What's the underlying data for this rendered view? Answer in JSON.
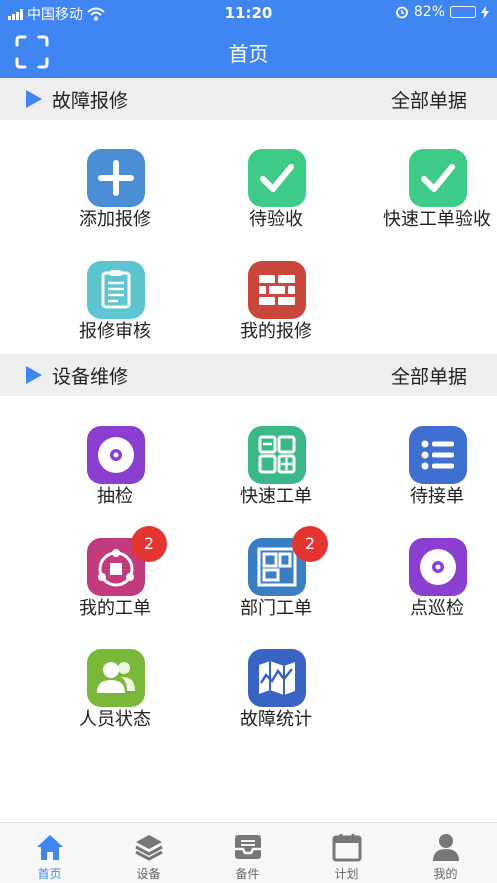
{
  "status_bar": {
    "carrier": "中国移动",
    "time": "11:20",
    "battery": "82%",
    "battery_level": 0.82
  },
  "header": {
    "title": "首页",
    "scan_icon": "scan-frame-icon"
  },
  "sections": [
    {
      "title": "故障报修",
      "all_label": "全部单据",
      "items": [
        {
          "label": "添加报修",
          "icon": "plus-icon",
          "color": "#4a8fd6"
        },
        {
          "label": "待验收",
          "icon": "checkmark-icon",
          "color": "#3ecb87"
        },
        {
          "label": "快速工单验收",
          "icon": "checkmark-icon",
          "color": "#3ecb87"
        },
        {
          "label": "报修审核",
          "icon": "clipboard-icon",
          "color": "#5cc5cf"
        },
        {
          "label": "我的报修",
          "icon": "brick-wall-icon",
          "color": "#c9473c"
        }
      ]
    },
    {
      "title": "设备维修",
      "all_label": "全部单据",
      "items": [
        {
          "label": "抽检",
          "icon": "target-disc-icon",
          "color": "#8a3fd1"
        },
        {
          "label": "快速工单",
          "icon": "calculator-icon",
          "color": "#3ab888"
        },
        {
          "label": "待接单",
          "icon": "list-icon",
          "color": "#3f6fd0"
        },
        {
          "label": "我的工单",
          "icon": "network-icon",
          "color": "#c23b7f",
          "badge": "2"
        },
        {
          "label": "部门工单",
          "icon": "floorplan-icon",
          "color": "#3a7fc4",
          "badge": "2"
        },
        {
          "label": "点巡检",
          "icon": "target-disc-icon",
          "color": "#8a3fd1"
        },
        {
          "label": "人员状态",
          "icon": "people-icon",
          "color": "#7ab83a"
        },
        {
          "label": "故障统计",
          "icon": "folded-map-icon",
          "color": "#3a64c4"
        }
      ]
    }
  ],
  "tabs": [
    {
      "label": "首页",
      "icon": "home-icon",
      "active": true
    },
    {
      "label": "设备",
      "icon": "layers-icon",
      "active": false
    },
    {
      "label": "备件",
      "icon": "inbox-icon",
      "active": false
    },
    {
      "label": "计划",
      "icon": "calendar-icon",
      "active": false
    },
    {
      "label": "我的",
      "icon": "user-icon",
      "active": false
    }
  ]
}
